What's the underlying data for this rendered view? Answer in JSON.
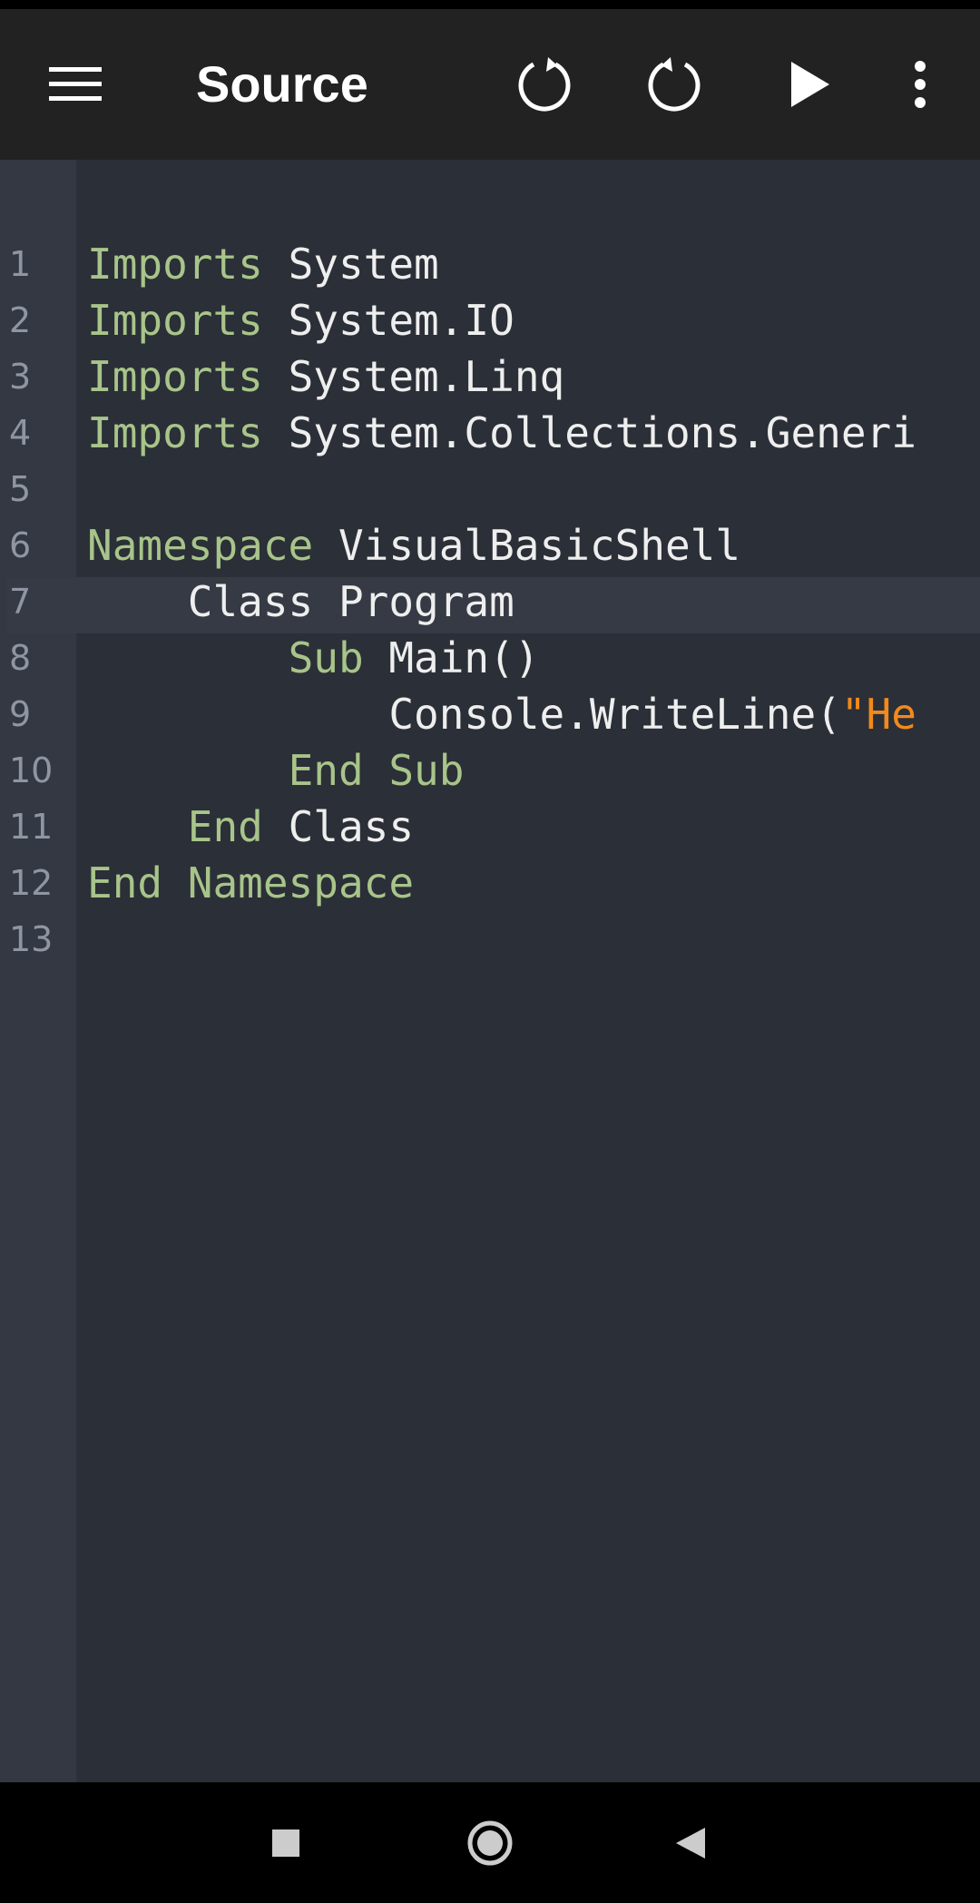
{
  "app_bar": {
    "title": "Source",
    "icons": [
      "menu-icon",
      "undo-icon",
      "redo-icon",
      "run-icon",
      "more-vert-icon"
    ]
  },
  "editor": {
    "current_line": 7,
    "lines": [
      {
        "num": "1",
        "indent": "",
        "tokens": [
          {
            "t": "Imports",
            "c": "kw"
          },
          {
            "t": " System",
            "c": ""
          }
        ]
      },
      {
        "num": "2",
        "indent": "",
        "tokens": [
          {
            "t": "Imports",
            "c": "kw"
          },
          {
            "t": " System.IO",
            "c": ""
          }
        ]
      },
      {
        "num": "3",
        "indent": "",
        "tokens": [
          {
            "t": "Imports",
            "c": "kw"
          },
          {
            "t": " System.Linq",
            "c": ""
          }
        ]
      },
      {
        "num": "4",
        "indent": "",
        "tokens": [
          {
            "t": "Imports",
            "c": "kw"
          },
          {
            "t": " System.Collections.Generi",
            "c": ""
          }
        ]
      },
      {
        "num": "5",
        "indent": "",
        "tokens": []
      },
      {
        "num": "6",
        "indent": "",
        "tokens": [
          {
            "t": "Namespace",
            "c": "kw"
          },
          {
            "t": " VisualBasicShell",
            "c": ""
          }
        ]
      },
      {
        "num": "7",
        "indent": "    ",
        "tokens": [
          {
            "t": "Class Program",
            "c": ""
          }
        ]
      },
      {
        "num": "8",
        "indent": "        ",
        "tokens": [
          {
            "t": "Sub",
            "c": "kw"
          },
          {
            "t": " Main()",
            "c": ""
          }
        ]
      },
      {
        "num": "9",
        "indent": "            ",
        "tokens": [
          {
            "t": "Console.WriteLine(",
            "c": ""
          },
          {
            "t": "\"He",
            "c": "str"
          }
        ]
      },
      {
        "num": "10",
        "indent": "        ",
        "tokens": [
          {
            "t": "End Sub",
            "c": "kw"
          }
        ]
      },
      {
        "num": "11",
        "indent": "    ",
        "tokens": [
          {
            "t": "End",
            "c": "kw"
          },
          {
            "t": " Class",
            "c": ""
          }
        ]
      },
      {
        "num": "12",
        "indent": "",
        "tokens": [
          {
            "t": "End Namespace",
            "c": "kw"
          }
        ]
      },
      {
        "num": "13",
        "indent": "",
        "tokens": []
      }
    ]
  },
  "colors": {
    "keyword": "#a8c48a",
    "string": "#f08a1c",
    "text": "#eeeeee",
    "line_number": "#8f96a3",
    "editor_bg": "#2b2f37",
    "gutter_bg": "#333842",
    "app_bar_bg": "#222222"
  },
  "nav_bar": {
    "icons": [
      "recents-square-icon",
      "home-circle-icon",
      "back-triangle-icon"
    ]
  }
}
